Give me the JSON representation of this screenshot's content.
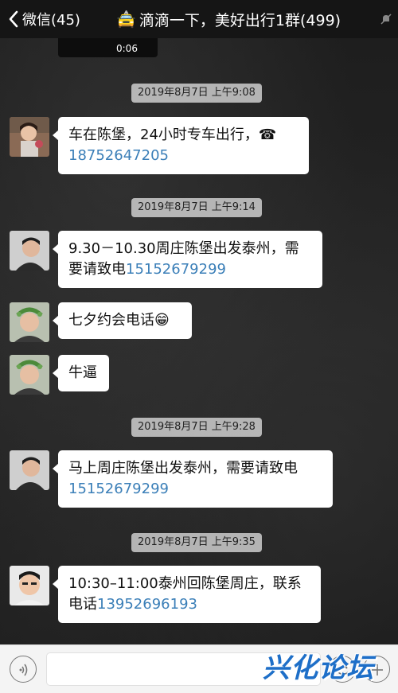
{
  "header": {
    "back_label": "微信(45)",
    "title_emoji": "🚖",
    "title": "滴滴一下，美好出行1群(499)"
  },
  "video": {
    "duration": "0:06"
  },
  "timestamps": [
    "2019年8月7日 上午9:08",
    "2019年8月7日 上午9:14",
    "2019年8月7日 上午9:28",
    "2019年8月7日 上午9:35"
  ],
  "messages": [
    {
      "line1": "车在陈堡，24小时专车出行，☎",
      "line2_text": "",
      "phone": "18752647205"
    },
    {
      "line1": "9.30－10.30周庄陈堡出发泰州，需",
      "line2_text": "要请致电",
      "phone": "15152679299"
    },
    {
      "line1": "七夕约会电话😁",
      "line2_text": "",
      "phone": ""
    },
    {
      "line1": "牛逼",
      "line2_text": "",
      "phone": ""
    },
    {
      "line1": "马上周庄陈堡出发泰州，需要请致电",
      "line2_text": "",
      "phone": "15152679299"
    },
    {
      "line1": "10:30–11:00泰州回陈堡周庄，联系",
      "line2_text": "电话",
      "phone": "13952696193"
    }
  ],
  "watermark": "兴化论坛",
  "colors": {
    "link": "#3b7fb8",
    "watermark": "#1e6fc8"
  }
}
